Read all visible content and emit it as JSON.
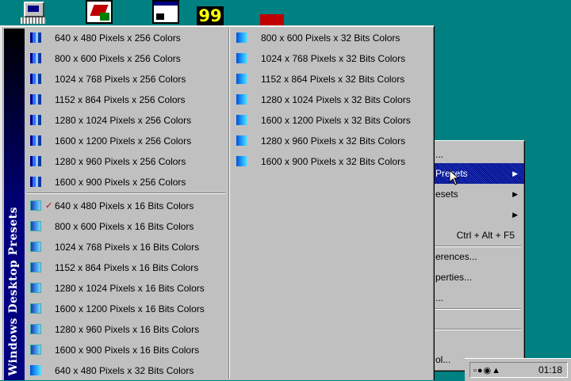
{
  "banner_title": "Windows Desktop Presets",
  "menu": {
    "column1_group1": [
      "640 x 480 Pixels x 256 Colors",
      "800 x 600 Pixels x 256 Colors",
      "1024 x 768 Pixels x 256 Colors",
      "1152 x 864 Pixels x 256 Colors",
      "1280 x 1024 Pixels x 256 Colors",
      "1600 x 1200 Pixels x 256 Colors",
      "1280 x 960 Pixels x 256 Colors",
      "1600 x 900 Pixels x 256 Colors"
    ],
    "column1_group2": [
      "640 x 480 Pixels x 16 Bits Colors",
      "800 x 600 Pixels x 16 Bits Colors",
      "1024 x 768 Pixels x 16 Bits Colors",
      "1152 x 864 Pixels x 16 Bits Colors",
      "1280 x 1024 Pixels x 16 Bits Colors",
      "1600 x 1200 Pixels x 16 Bits Colors",
      "1280 x 960 Pixels x 16 Bits Colors",
      "1600 x 900 Pixels x 16 Bits Colors",
      "640 x 480 Pixels x 32 Bits Colors"
    ],
    "column2": [
      "800 x 600 Pixels x 32 Bits Colors",
      "1024 x 768 Pixels x 32 Bits Colors",
      "1152 x 864 Pixels x 32 Bits Colors",
      "1280 x 1024 Pixels x 32 Bits Colors",
      "1600 x 1200 Pixels x 32 Bits Colors",
      "1280 x 960 Pixels x 32 Bits Colors",
      "1600 x 900 Pixels x 32 Bits Colors"
    ],
    "checked_item": "640 x 480 Pixels x 16 Bits Colors",
    "check_mark": "✓"
  },
  "context_menu": {
    "item_top": "...",
    "presets_highlighted": "Presets",
    "presets_other": "esets",
    "shortcut_item_label": "Ctrl + Alt + F5",
    "preferences": "erences...",
    "properties": "perties...",
    "dots": "...",
    "tool": "ol..."
  },
  "desktop": {
    "yellow_icon_text": "99"
  },
  "taskbar": {
    "clock": "01:18"
  },
  "colors": {
    "desktop": "#008080",
    "menu_face": "#c0c0c0",
    "banner": "#000080",
    "check": "#c00000"
  },
  "icons": [
    "monitor-icon",
    "document-icon",
    "window-icon",
    "display-settings-icon",
    "arrow-cursor-icon"
  ]
}
